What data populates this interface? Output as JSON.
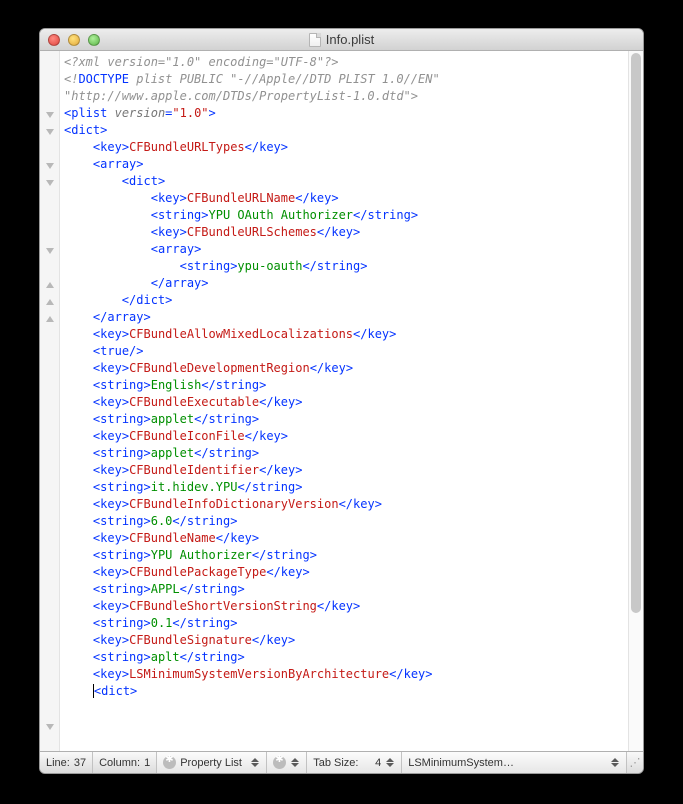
{
  "titlebar": {
    "filename": "Info.plist"
  },
  "code": {
    "xml_decl": "<?xml version=\"1.0\" encoding=\"UTF-8\"?>",
    "doctype_prefix": "<!",
    "doctype_kw": "DOCTYPE",
    "doctype_rest": " plist PUBLIC \"-//Apple//DTD PLIST 1.0//EN\"",
    "doctype_url": "\"http://www.apple.com/DTDs/PropertyList-1.0.dtd\">",
    "plist_open_tag": "plist",
    "plist_version_attr": "version",
    "plist_version_val": "\"1.0\"",
    "keys": {
      "urltypes": "CFBundleURLTypes",
      "urlname": "CFBundleURLName",
      "urlschemes": "CFBundleURLSchemes",
      "mixedloc": "CFBundleAllowMixedLocalizations",
      "devregion": "CFBundleDevelopmentRegion",
      "exec": "CFBundleExecutable",
      "iconfile": "CFBundleIconFile",
      "identifier": "CFBundleIdentifier",
      "infodict": "CFBundleInfoDictionaryVersion",
      "name": "CFBundleName",
      "pkgtype": "CFBundlePackageType",
      "shortver": "CFBundleShortVersionString",
      "signature": "CFBundleSignature",
      "minsys": "LSMinimumSystemVersionByArchitecture"
    },
    "str": {
      "authorizer": "YPU OAuth Authorizer",
      "scheme": "ypu-oauth",
      "english": "English",
      "applet": "applet",
      "applet2": "applet",
      "identifier": "it.hidev.YPU",
      "six": "6.0",
      "appname": "YPU Authorizer",
      "appl": "APPL",
      "ver": "0.1",
      "aplt": "aplt"
    }
  },
  "status": {
    "line_label": "Line:",
    "line_val": "37",
    "col_label": "Column:",
    "col_val": "1",
    "lang": "Property List",
    "tab_label": "Tab Size:",
    "tab_val": "4",
    "symbol": "LSMinimumSystem…"
  }
}
